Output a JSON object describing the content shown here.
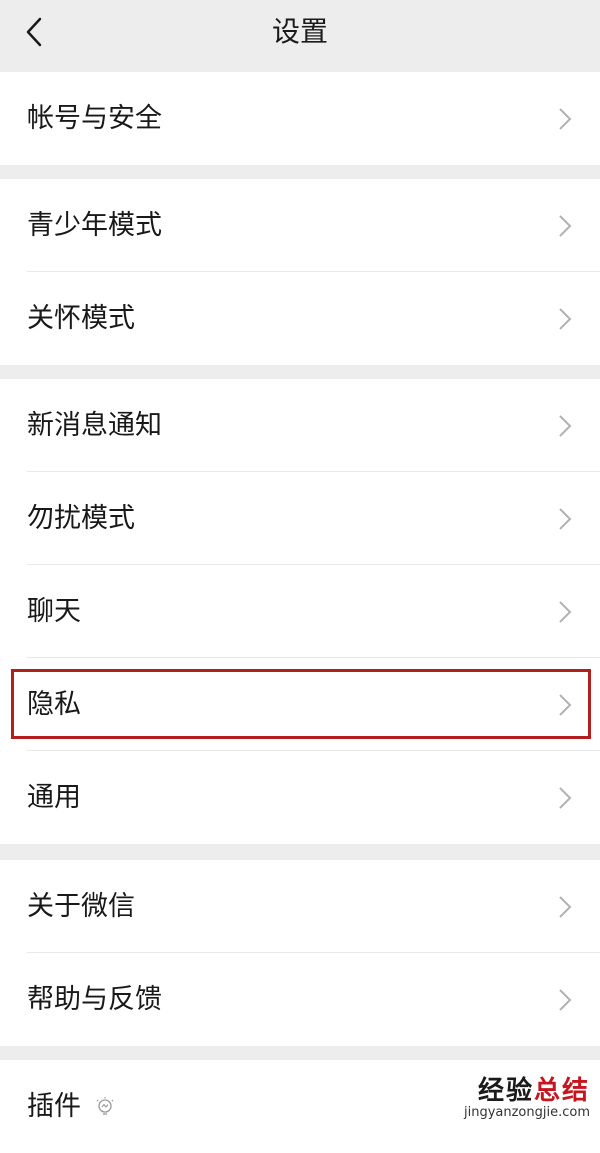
{
  "header": {
    "title": "设置",
    "back_icon": "chevron-left-icon"
  },
  "groups": [
    {
      "items": [
        {
          "label": "帐号与安全"
        }
      ]
    },
    {
      "items": [
        {
          "label": "青少年模式"
        },
        {
          "label": "关怀模式"
        }
      ]
    },
    {
      "items": [
        {
          "label": "新消息通知"
        },
        {
          "label": "勿扰模式"
        },
        {
          "label": "聊天"
        },
        {
          "label": "隐私"
        },
        {
          "label": "通用"
        }
      ]
    },
    {
      "items": [
        {
          "label": "关于微信"
        },
        {
          "label": "帮助与反馈"
        }
      ]
    },
    {
      "items": [
        {
          "label": "插件",
          "icon": "lightbulb-icon"
        }
      ]
    }
  ],
  "highlight": {
    "item": "隐私",
    "color": "#b21f1f"
  },
  "watermark": {
    "main_a": "经验",
    "main_b": "总结",
    "sub": "jingyanzongjie.com"
  },
  "colors": {
    "background": "#ededed",
    "panel": "#ffffff",
    "text": "#191919",
    "chevron": "#b2b2b2"
  }
}
